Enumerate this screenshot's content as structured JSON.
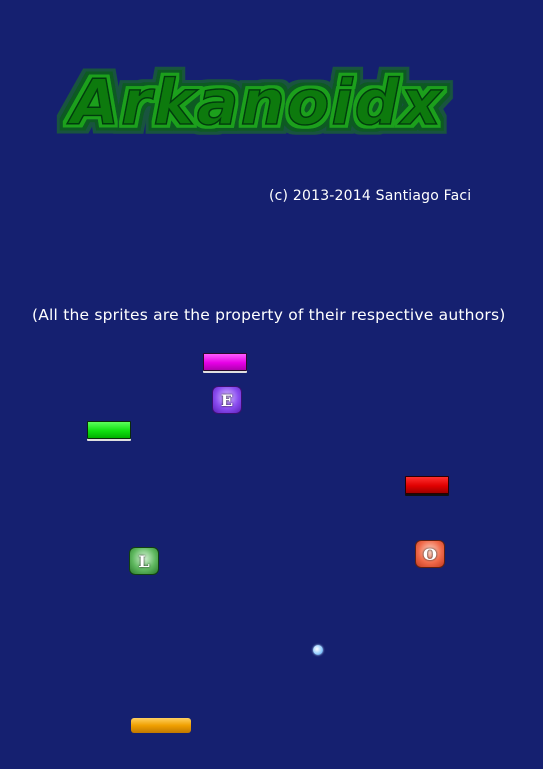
{
  "game": {
    "title": "Arkanoidx",
    "credit": "(c) 2013-2014 Santiago Faci",
    "notice": "(All the sprites are the property of their respective authors)",
    "powerups": {
      "e": "E",
      "l": "L",
      "o": "O"
    },
    "colors": {
      "background": "#152070",
      "logo_text": "#0a7a10",
      "logo_glow": "#1fa01f",
      "brick_magenta": "#e600e6",
      "brick_green": "#10e010",
      "brick_red": "#e00000",
      "paddle": "#f0a000",
      "ball": "#8ecbff"
    }
  }
}
